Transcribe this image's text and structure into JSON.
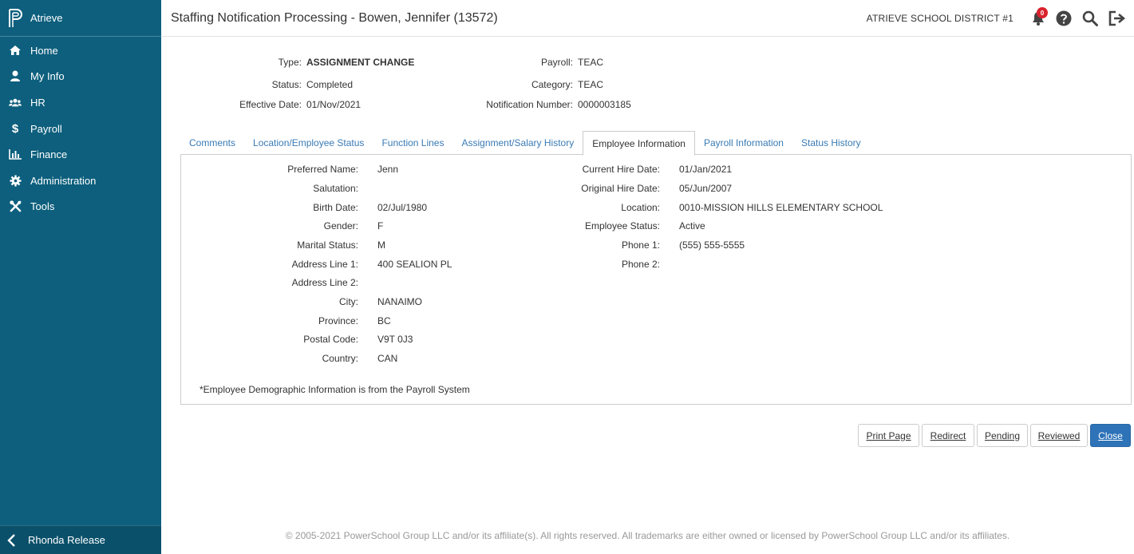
{
  "app": {
    "name": "Atrieve"
  },
  "sidebar": {
    "items": [
      {
        "label": "Home",
        "icon": "home-icon"
      },
      {
        "label": "My Info",
        "icon": "user-icon"
      },
      {
        "label": "HR",
        "icon": "users-icon"
      },
      {
        "label": "Payroll",
        "icon": "dollar-icon"
      },
      {
        "label": "Finance",
        "icon": "bar-chart-icon"
      },
      {
        "label": "Administration",
        "icon": "gear-icon"
      },
      {
        "label": "Tools",
        "icon": "tools-icon"
      }
    ],
    "user": "Rhonda Release"
  },
  "header": {
    "title": "Staffing Notification Processing - Bowen, Jennifer (13572)",
    "district": "ATRIEVE SCHOOL DISTRICT #1",
    "notification_count": "0"
  },
  "summary": {
    "type_label": "Type:",
    "type_value": "ASSIGNMENT CHANGE",
    "status_label": "Status:",
    "status_value": "Completed",
    "effective_label": "Effective Date:",
    "effective_value": "01/Nov/2021",
    "payroll_label": "Payroll:",
    "payroll_value": "TEAC",
    "category_label": "Category:",
    "category_value": "TEAC",
    "notification_label": "Notification Number:",
    "notification_value": "0000003185"
  },
  "tabs": [
    {
      "label": "Comments"
    },
    {
      "label": "Location/Employee Status"
    },
    {
      "label": "Function Lines"
    },
    {
      "label": "Assignment/Salary History"
    },
    {
      "label": "Employee Information"
    },
    {
      "label": "Payroll Information"
    },
    {
      "label": "Status History"
    }
  ],
  "employee": {
    "left": [
      {
        "label": "Preferred Name:",
        "value": "Jenn"
      },
      {
        "label": "Salutation:",
        "value": ""
      },
      {
        "label": "Birth Date:",
        "value": "02/Jul/1980"
      },
      {
        "label": "Gender:",
        "value": "F"
      },
      {
        "label": "Marital Status:",
        "value": "M"
      },
      {
        "label": "Address Line 1:",
        "value": "400 SEALION PL"
      },
      {
        "label": "Address Line 2:",
        "value": ""
      },
      {
        "label": "City:",
        "value": "NANAIMO"
      },
      {
        "label": "Province:",
        "value": "BC"
      },
      {
        "label": "Postal Code:",
        "value": "V9T 0J3"
      },
      {
        "label": "Country:",
        "value": "CAN"
      }
    ],
    "right": [
      {
        "label": "Current Hire Date:",
        "value": "01/Jan/2021"
      },
      {
        "label": "Original Hire Date:",
        "value": "05/Jun/2007"
      },
      {
        "label": "Location:",
        "value": "0010-MISSION HILLS ELEMENTARY SCHOOL"
      },
      {
        "label": "Employee Status:",
        "value": "Active"
      },
      {
        "label": "Phone 1:",
        "value": "(555) 555-5555"
      },
      {
        "label": "Phone 2:",
        "value": ""
      }
    ],
    "note": "*Employee Demographic Information is from the Payroll System"
  },
  "buttons": {
    "print": "Print Page",
    "redirect": "Redirect",
    "pending": "Pending",
    "reviewed": "Reviewed",
    "close": "Close"
  },
  "footer": "© 2005-2021 PowerSchool Group LLC and/or its affiliate(s). All rights reserved. All trademarks are either owned or licensed by PowerSchool Group LLC and/or its affiliates.",
  "colors": {
    "sidebar": "#0d5f7d",
    "primary_button": "#2e73b8",
    "link": "#3a7bb5",
    "badge": "#d9232d"
  }
}
